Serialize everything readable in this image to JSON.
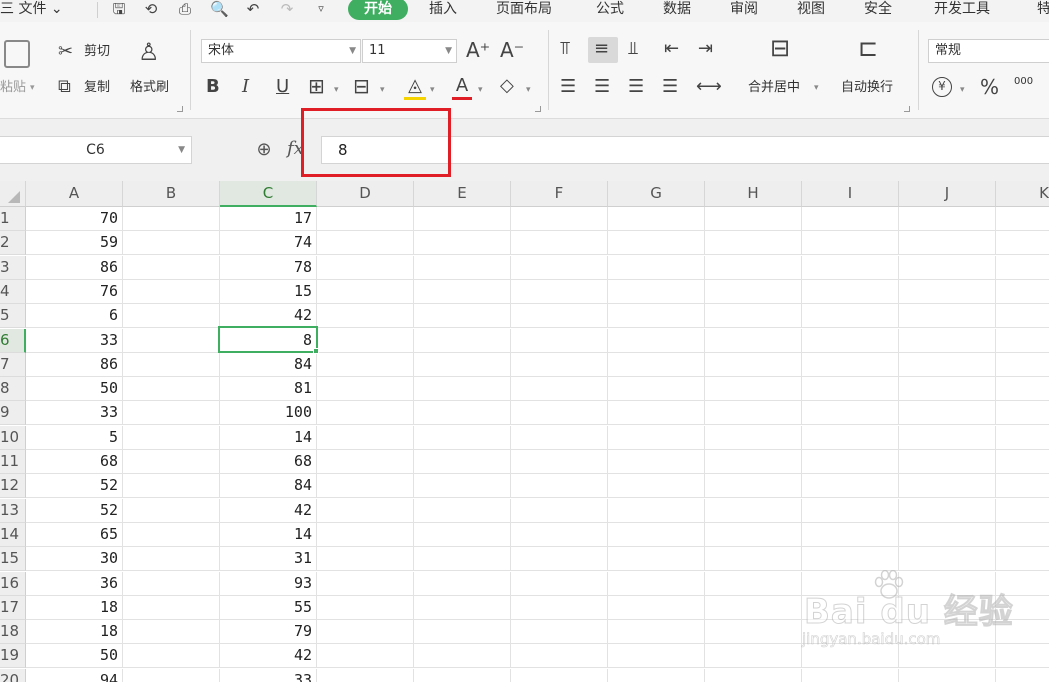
{
  "menu": {
    "file_label": "三 文件 ⌄",
    "tabs": [
      "开始",
      "插入",
      "页面布局",
      "公式",
      "数据",
      "审阅",
      "视图",
      "安全",
      "开发工具",
      "特"
    ],
    "active_tab": "开始"
  },
  "quick_access": [
    "save-icon",
    "sync-icon",
    "print-icon",
    "print-preview-icon",
    "undo-icon",
    "redo-icon",
    "dropdown-icon"
  ],
  "ribbon": {
    "paste": "粘贴",
    "cut": "剪切",
    "copy": "复制",
    "format_painter": "格式刷",
    "font_name": "宋体",
    "font_size": "11",
    "increase_font": "A⁺",
    "decrease_font": "A⁻",
    "bold": "B",
    "italic": "I",
    "underline": "U",
    "merge_center": "合并居中",
    "wrap_text": "自动换行",
    "number_format": "常规",
    "currency": "¥",
    "percent": "%",
    "thousands": "000"
  },
  "formula_bar": {
    "cell_ref": "C6",
    "content": "8",
    "fx": "fx"
  },
  "grid": {
    "columns": [
      "A",
      "B",
      "C",
      "D",
      "E",
      "F",
      "G",
      "H",
      "I",
      "J",
      "K"
    ],
    "selected_column": "C",
    "selected_row": "6",
    "rows": [
      {
        "num": "1",
        "a": "70",
        "c": "17"
      },
      {
        "num": "2",
        "a": "59",
        "c": "74"
      },
      {
        "num": "3",
        "a": "86",
        "c": "78"
      },
      {
        "num": "4",
        "a": "76",
        "c": "15"
      },
      {
        "num": "5",
        "a": "6",
        "c": "42"
      },
      {
        "num": "6",
        "a": "33",
        "c": "8"
      },
      {
        "num": "7",
        "a": "86",
        "c": "84"
      },
      {
        "num": "8",
        "a": "50",
        "c": "81"
      },
      {
        "num": "9",
        "a": "33",
        "c": "100"
      },
      {
        "num": "10",
        "a": "5",
        "c": "14"
      },
      {
        "num": "11",
        "a": "68",
        "c": "68"
      },
      {
        "num": "12",
        "a": "52",
        "c": "84"
      },
      {
        "num": "13",
        "a": "52",
        "c": "42"
      },
      {
        "num": "14",
        "a": "65",
        "c": "14"
      },
      {
        "num": "15",
        "a": "30",
        "c": "31"
      },
      {
        "num": "16",
        "a": "36",
        "c": "93"
      },
      {
        "num": "17",
        "a": "18",
        "c": "55"
      },
      {
        "num": "18",
        "a": "18",
        "c": "79"
      },
      {
        "num": "19",
        "a": "50",
        "c": "42"
      },
      {
        "num": "20",
        "a": "94",
        "c": "33"
      }
    ]
  },
  "watermark": {
    "logo": "Bai du 经验",
    "url": "jingyan.baidu.com"
  },
  "colors": {
    "accent_green": "#3fae61",
    "highlight_red": "#e01e25"
  }
}
